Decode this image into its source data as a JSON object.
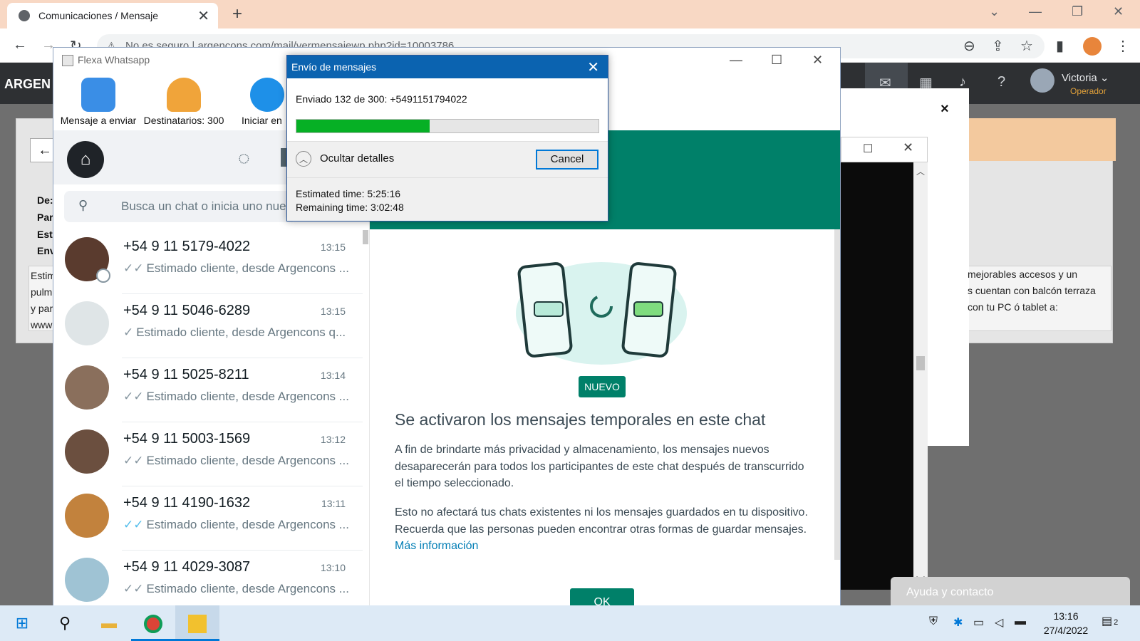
{
  "browser": {
    "tab_title": "Comunicaciones / Mensaje",
    "new_tab": "+",
    "url_text": "No es seguro | argencons.com/mail/vermensajewp.php?id=10003786",
    "win_min": "—",
    "win_max": "❐",
    "win_close": "✕",
    "tab_close": "✕"
  },
  "webapp": {
    "logo": "ARGEN",
    "user_name": "Victoria ⌄",
    "user_role": "Operador",
    "labels": [
      "De:",
      "Par",
      "Est",
      "Env"
    ],
    "body_left": "Estim\npulm\ny par\nwww",
    "body_right": "mejorables accesos y un\ns cuentan con balcón terraza\ncon tu PC ó tablet a:",
    "help_button": "Ayuda y contacto",
    "dialog_close": "×"
  },
  "flexa": {
    "title": "Flexa Whatsapp",
    "ribbon": [
      {
        "label": "Mensaje a enviar",
        "icon": "message-icon",
        "color": "#3a8ee6"
      },
      {
        "label": "Destinatarios: 300",
        "icon": "group-icon",
        "color": "#f0a43a"
      },
      {
        "label": "Iniciar en",
        "icon": "play-icon",
        "color": "#1e90e8"
      }
    ]
  },
  "whatsapp": {
    "search_placeholder": "Busca un chat o inicia uno nue",
    "chats": [
      {
        "name": "+54 9 11 5179-4022",
        "time": "13:15",
        "preview": "Estimado cliente, desde Argencons ...",
        "ticks": "✓✓",
        "read": false,
        "avatar_color": "#5a3b2e"
      },
      {
        "name": "+54 9 11 5046-6289",
        "time": "13:15",
        "preview": "Estimado cliente, desde Argencons q...",
        "ticks": "✓",
        "read": false,
        "avatar_color": "#dfe5e7"
      },
      {
        "name": "+54 9 11 5025-8211",
        "time": "13:14",
        "preview": "Estimado cliente, desde Argencons ...",
        "ticks": "✓✓",
        "read": false,
        "avatar_color": "#8a6f5c"
      },
      {
        "name": "+54 9 11 5003-1569",
        "time": "13:12",
        "preview": "Estimado cliente, desde Argencons ...",
        "ticks": "✓✓",
        "read": false,
        "avatar_color": "#6b4f3f"
      },
      {
        "name": "+54 9 11 4190-1632",
        "time": "13:11",
        "preview": "Estimado cliente, desde Argencons ...",
        "ticks": "✓✓",
        "read": true,
        "avatar_color": "#c2823d"
      },
      {
        "name": "+54 9 11 4029-3087",
        "time": "13:10",
        "preview": "Estimado cliente, desde Argencons ...",
        "ticks": "✓✓",
        "read": false,
        "avatar_color": "#9fc3d4"
      }
    ],
    "badge": "NUEVO",
    "headline": "Se activaron los mensajes temporales en este chat",
    "para1": "A fin de brindarte más privacidad y almacenamiento, los mensajes nuevos desaparecerán para todos los participantes de este chat después de transcurrido el tiempo seleccionado.",
    "para2": "Esto no afectará tus chats existentes ni los mensajes guardados en tu dispositivo. Recuerda que las personas pueden encontrar otras formas de guardar mensajes.",
    "more_info": "Más información",
    "ok": "OK",
    "accent_color": "#008069"
  },
  "progress_dialog": {
    "title": "Envío de mensajes",
    "close": "✕",
    "status": "Enviado 132 de 300: +5491151794022",
    "sent": 132,
    "total": 300,
    "hide_details": "Ocultar detalles",
    "cancel": "Cancel",
    "estimated": "Estimated time: 5:25:16",
    "remaining": "Remaining time: 3:02:48"
  },
  "taskbar": {
    "time": "13:16",
    "date": "27/4/2022",
    "notifications": "2"
  }
}
